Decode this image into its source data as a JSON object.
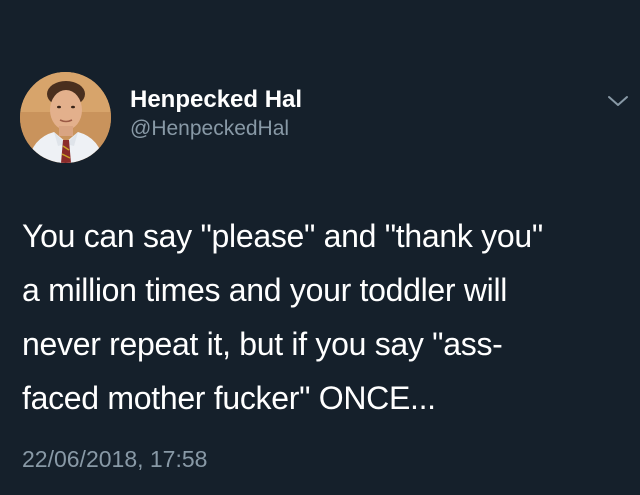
{
  "author": {
    "display_name": "Henpecked Hal",
    "handle": "@HenpeckedHal",
    "avatar_icon": "profile-photo"
  },
  "tweet": {
    "lines": [
      "You can say \"please\" and \"thank you\"",
      "a million times and your toddler will",
      "never repeat it, but if you say \"ass-",
      "faced mother fucker\" ONCE..."
    ],
    "timestamp": "22/06/2018, 17:58"
  },
  "menu": {
    "icon": "chevron-down-icon"
  },
  "colors": {
    "background": "#15202b",
    "primary_text": "#ffffff",
    "secondary_text": "#8899a6"
  }
}
